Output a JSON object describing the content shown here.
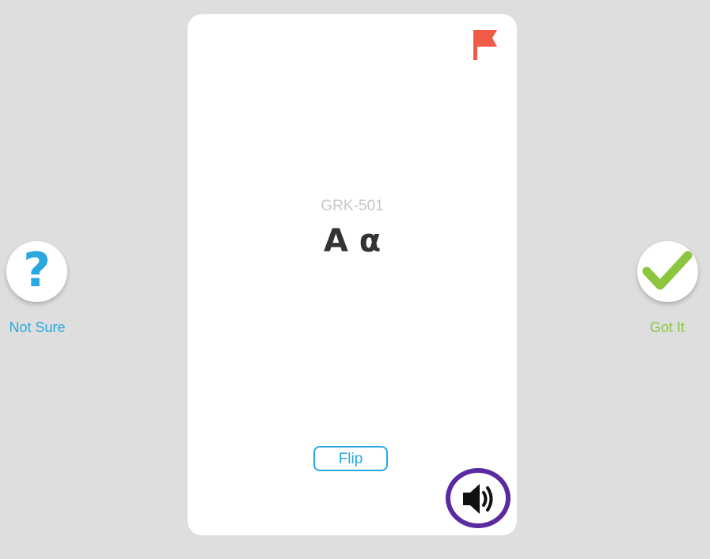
{
  "card": {
    "code": "GRK-501",
    "term": "Α α",
    "flip_label": "Flip"
  },
  "actions": {
    "not_sure_label": "Not Sure",
    "got_it_label": "Got It"
  },
  "colors": {
    "background": "#dedede",
    "card": "#ffffff",
    "flag": "#f05a46",
    "accent_blue": "#29a8e0",
    "accent_green": "#8cc63f",
    "audio_ring": "#5a2aa0",
    "term_text": "#333333",
    "code_text": "#c8c8c8"
  },
  "icons": {
    "flag": "flag-icon",
    "audio": "speaker-icon",
    "not_sure": "question-mark-icon",
    "got_it": "checkmark-icon"
  }
}
